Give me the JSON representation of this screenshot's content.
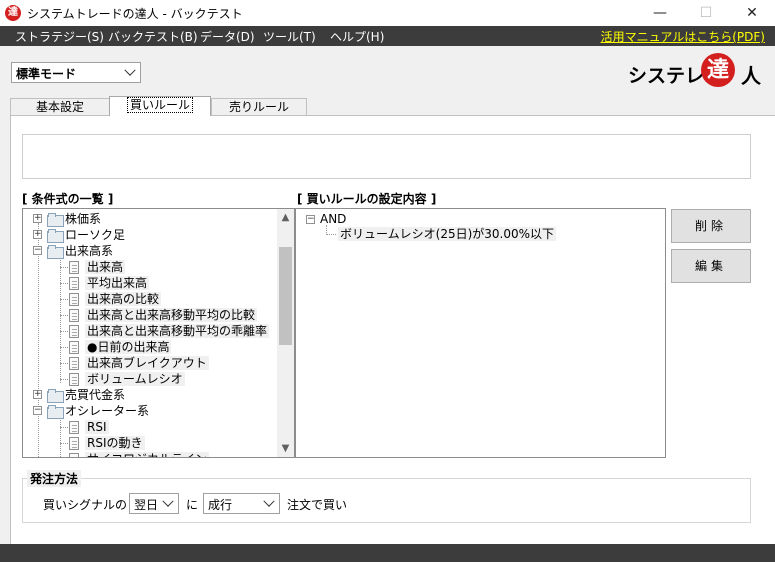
{
  "window": {
    "app_icon_glyph": "達",
    "title": "システムトレードの達人 - バックテスト",
    "minimize_glyph": "—",
    "maximize_glyph": "☐",
    "close_glyph": "✕"
  },
  "menu": {
    "items": [
      "ストラテジー(S)",
      "バックテスト(B)",
      "データ(D)",
      "ツール(T)",
      "ヘルプ(H)"
    ],
    "manual_link": "活用マニュアルはこちら(PDF)",
    "manual_link_color": "#ffff00"
  },
  "mode": {
    "selected": "標準モード"
  },
  "logo": {
    "text": "システレの",
    "circle_char": "達",
    "last_char": "人",
    "accent": "#d41f1f"
  },
  "tabs": [
    {
      "label": "基本設定",
      "active": false
    },
    {
      "label": "買いルール",
      "active": true
    },
    {
      "label": "売りルール",
      "active": false
    }
  ],
  "description": "",
  "conditions": {
    "header": "[ 条件式の一覧 ]",
    "tree": [
      {
        "label": "株価系",
        "type": "folder",
        "expanded": false
      },
      {
        "label": "ローソク足",
        "type": "folder",
        "expanded": false
      },
      {
        "label": "出来高系",
        "type": "folder",
        "expanded": true
      },
      {
        "label": "出来高",
        "type": "item"
      },
      {
        "label": "平均出来高",
        "type": "item"
      },
      {
        "label": "出来高の比較",
        "type": "item"
      },
      {
        "label": "出来高と出来高移動平均の比較",
        "type": "item"
      },
      {
        "label": "出来高と出来高移動平均の乖離率",
        "type": "item"
      },
      {
        "label": "●日前の出来高",
        "type": "item"
      },
      {
        "label": "出来高ブレイクアウト",
        "type": "item"
      },
      {
        "label": "ボリュームレシオ",
        "type": "item"
      },
      {
        "label": "売買代金系",
        "type": "folder",
        "expanded": false
      },
      {
        "label": "オシレーター系",
        "type": "folder",
        "expanded": true
      },
      {
        "label": "RSI",
        "type": "item"
      },
      {
        "label": "RSIの動き",
        "type": "item"
      },
      {
        "label": "サイコロジカルライン",
        "type": "item"
      }
    ]
  },
  "rules": {
    "header": "[ 買いルールの設定内容 ]",
    "root": "AND",
    "children": [
      "ボリュームレシオ(25日)が30.00%以下"
    ]
  },
  "buttons": {
    "delete": "削除",
    "edit": "編集"
  },
  "order": {
    "title": "発注方法",
    "prefix": "買いシグナルの",
    "timing": "翌日",
    "ni": "に",
    "method": "成行",
    "suffix": "注文で買い"
  }
}
